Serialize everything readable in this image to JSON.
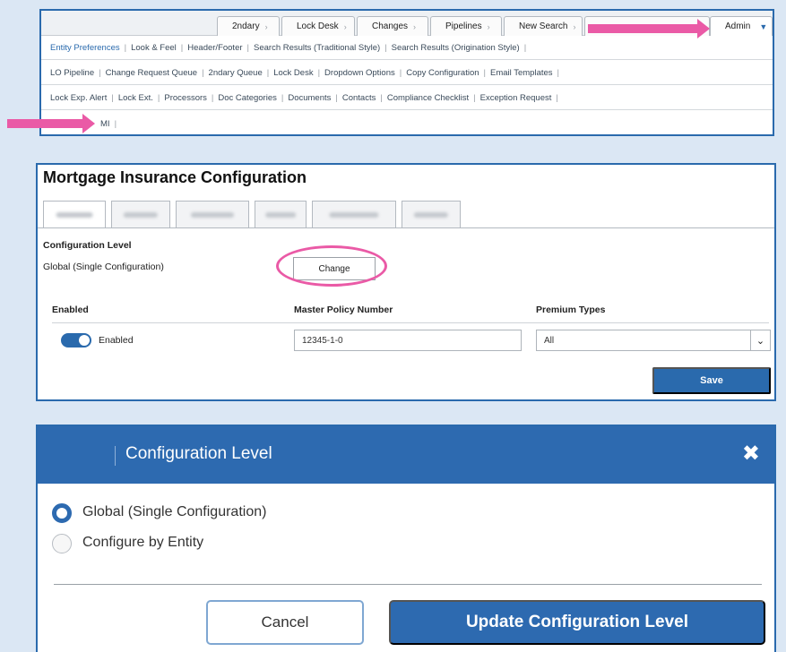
{
  "nav": {
    "top_tabs": [
      "2ndary",
      "Lock Desk",
      "Changes",
      "Pipelines",
      "New Search",
      ""
    ],
    "admin_tab": "Admin",
    "row1": [
      "Entity Preferences",
      "Look & Feel",
      "Header/Footer",
      "Search Results (Traditional Style)",
      "Search Results (Origination Style)"
    ],
    "row2": [
      "LO Pipeline",
      "Change Request Queue",
      "2ndary Queue",
      "Lock Desk",
      "Dropdown Options",
      "Copy Configuration",
      "Email Templates"
    ],
    "row3": [
      "Lock Exp. Alert",
      "Lock Ext.",
      "Processors",
      "Doc Categories",
      "Documents",
      "Contacts",
      "Compliance Checklist",
      "Exception Request"
    ],
    "row4": [
      "MI"
    ]
  },
  "mi_config": {
    "title": "Mortgage Insurance Configuration",
    "config_level_label": "Configuration Level",
    "config_level_value": "Global (Single Configuration)",
    "change_button": "Change",
    "col_enabled": "Enabled",
    "col_master_policy": "Master Policy Number",
    "col_premium_types": "Premium Types",
    "toggle_label": "Enabled",
    "toggle_on": true,
    "master_policy_value": "12345-1-0",
    "premium_type_selected": "All",
    "save_button": "Save"
  },
  "modal": {
    "title": "Configuration Level",
    "options": [
      "Global (Single Configuration)",
      "Configure by Entity"
    ],
    "selected_index": 0,
    "cancel_button": "Cancel",
    "update_button": "Update Configuration Level"
  },
  "colors": {
    "primary": "#2d6ab0",
    "highlight": "#ea5aa6",
    "background": "#dbe7f4"
  }
}
